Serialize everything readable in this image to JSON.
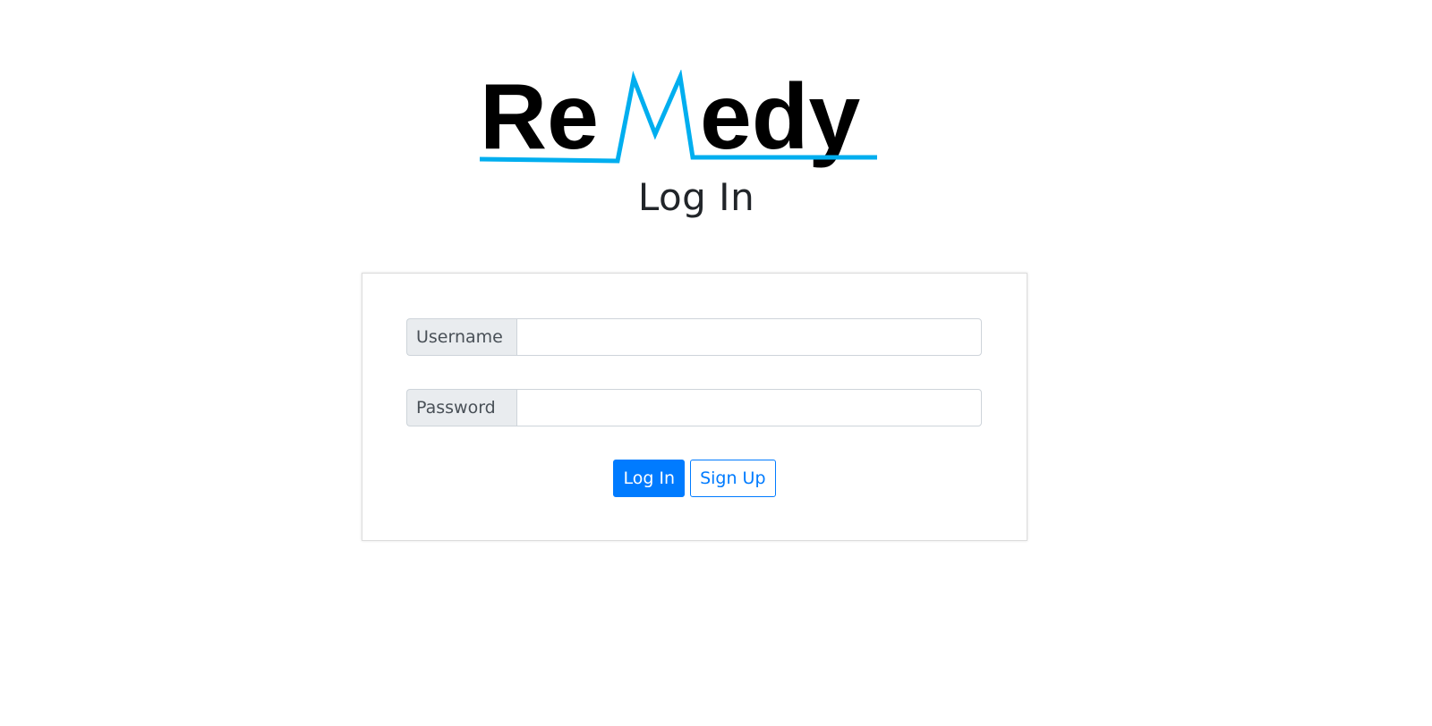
{
  "logo": {
    "text": "ReMedy",
    "accent_color": "#00aeef",
    "text_color": "#000000"
  },
  "page_title": "Log In",
  "form": {
    "username_label": "Username",
    "username_value": "",
    "password_label": "Password",
    "password_value": ""
  },
  "buttons": {
    "login_label": "Log In",
    "signup_label": "Sign Up"
  },
  "colors": {
    "primary": "#007bff",
    "prepend_bg": "#e9ecef",
    "border": "#ced4da"
  }
}
